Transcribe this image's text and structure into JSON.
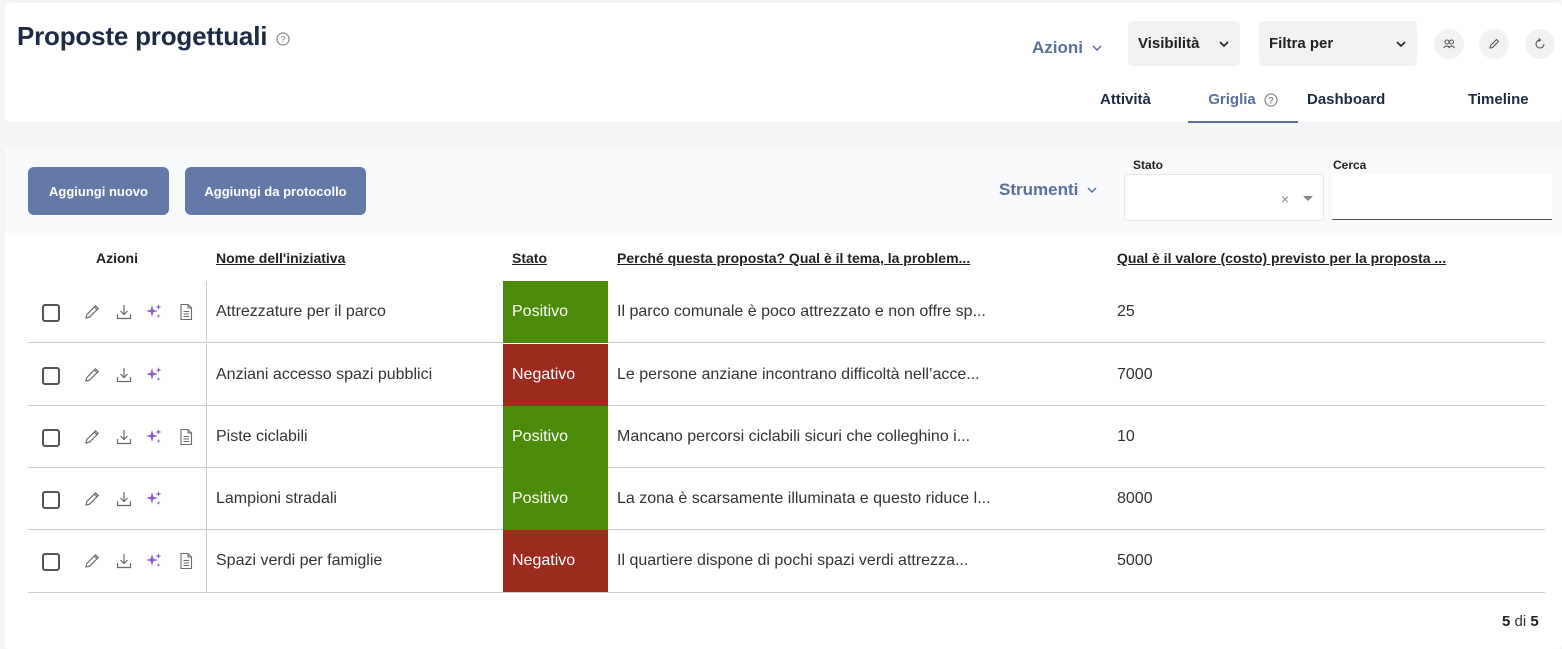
{
  "header": {
    "title": "Proposte progettuali",
    "azioni_label": "Azioni",
    "visibilita_label": "Visibilità",
    "filtra_label": "Filtra per",
    "tabs": [
      {
        "label": "Attività",
        "active": false
      },
      {
        "label": "Griglia",
        "active": true
      },
      {
        "label": "Dashboard",
        "active": false
      },
      {
        "label": "Timeline",
        "active": false
      }
    ]
  },
  "toolbar": {
    "add_new_label": "Aggiungi nuovo",
    "add_protocol_label": "Aggiungi da protocollo",
    "strumenti_label": "Strumenti",
    "stato_label": "Stato",
    "stato_value": "",
    "cerca_label": "Cerca",
    "cerca_value": ""
  },
  "table": {
    "columns": [
      "Azioni",
      "Nome dell'iniziativa",
      "Stato",
      "Perché questa proposta? Qual è il tema, la problem...",
      "Qual è il valore (costo) previsto per la proposta ..."
    ],
    "rows": [
      {
        "name": "Attrezzature per il parco",
        "status": "Positivo",
        "reason": "Il parco comunale è poco attrezzato e non offre sp...",
        "value": "25",
        "has_doc": true
      },
      {
        "name": "Anziani accesso spazi pubblici",
        "status": "Negativo",
        "reason": "Le persone anziane incontrano difficoltà nell’acce...",
        "value": "7000",
        "has_doc": false
      },
      {
        "name": "Piste ciclabili",
        "status": "Positivo",
        "reason": "Mancano percorsi ciclabili sicuri che colleghino i...",
        "value": "10",
        "has_doc": true
      },
      {
        "name": "Lampioni stradali",
        "status": "Positivo",
        "reason": "La zona è scarsamente illuminata e questo riduce l...",
        "value": "8000",
        "has_doc": false
      },
      {
        "name": "Spazi verdi per famiglie",
        "status": "Negativo",
        "reason": "Il quartiere dispone di pochi spazi verdi attrezza...",
        "value": "5000",
        "has_doc": true
      }
    ]
  },
  "pagination": {
    "shown": "5",
    "of_label": "di",
    "total": "5"
  },
  "colors": {
    "accent": "#5a6f99",
    "button": "#6379a7",
    "positive": "#4a8c0a",
    "negative": "#9c2a1f",
    "sparkle": "#8a5cc8"
  }
}
